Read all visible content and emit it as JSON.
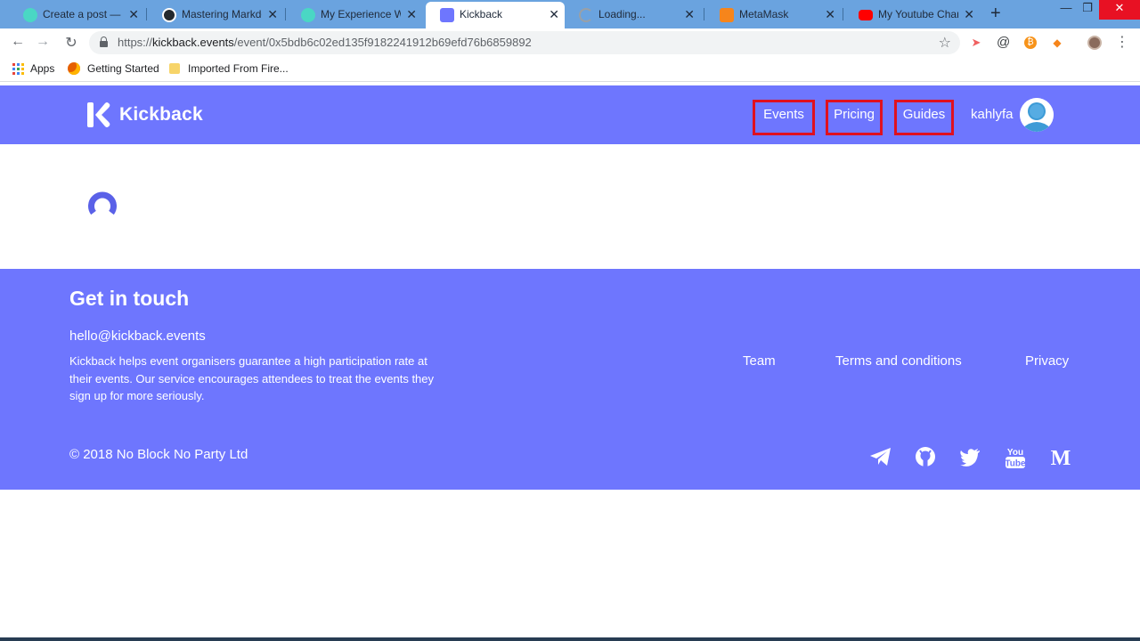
{
  "browser": {
    "tabs": [
      {
        "label": "Create a post — Sti",
        "favicon": "steemit-icon",
        "color": "#4ad7c4",
        "active": false
      },
      {
        "label": "Mastering Markdo",
        "favicon": "github-icon",
        "color": "#24292e",
        "active": false
      },
      {
        "label": "My Experience With",
        "favicon": "steemit-icon",
        "color": "#4ad7c4",
        "active": false
      },
      {
        "label": "Kickback",
        "favicon": "kickback-icon",
        "color": "#6e76fe",
        "active": true
      },
      {
        "label": "Loading...",
        "favicon": "loading-icon",
        "color": "#9aa0a6",
        "active": false
      },
      {
        "label": "MetaMask",
        "favicon": "metamask-icon",
        "color": "#f6851b",
        "active": false
      },
      {
        "label": "My Youtube Chann",
        "favicon": "youtube-icon",
        "color": "#ff0000",
        "active": false
      }
    ],
    "new_tab": "+",
    "window_controls": {
      "minimize": "—",
      "restore": "❐",
      "close": "✕"
    },
    "url": {
      "scheme": "https://",
      "host": "kickback.events",
      "path": "/event/0x5bdb6c02ed135f9182241912b69efd76b6859892"
    },
    "bookmarks": [
      {
        "label": "Apps",
        "icon": "apps-grid-icon"
      },
      {
        "label": "Getting Started",
        "icon": "firefox-icon"
      },
      {
        "label": "Imported From Fire...",
        "icon": "folder-icon"
      }
    ],
    "extensions": [
      {
        "name": "extension-arrow-icon",
        "color": "#f06060",
        "glyph": "➤"
      },
      {
        "name": "extension-at-icon",
        "color": "#5f6368",
        "glyph": "@"
      },
      {
        "name": "bitcoin-extension-icon",
        "color": "#f7931a",
        "glyph": "₿"
      },
      {
        "name": "metamask-extension-icon",
        "color": "#f6851b",
        "glyph": "◆"
      }
    ]
  },
  "site": {
    "brand": "Kickback",
    "nav": [
      {
        "label": "Events"
      },
      {
        "label": "Pricing"
      },
      {
        "label": "Guides"
      }
    ],
    "username": "kahlyfa",
    "footer": {
      "title": "Get in touch",
      "email": "hello@kickback.events",
      "description": "Kickback helps event organisers guarantee a high participation rate at their events. Our service encourages attendees to treat the events they sign up for more seriously.",
      "links": [
        "Team",
        "Terms and conditions",
        "Privacy"
      ],
      "copyright": "© 2018 No Block No Party Ltd",
      "social": [
        "telegram-icon",
        "github-icon",
        "twitter-icon",
        "youtube-icon",
        "medium-icon"
      ]
    },
    "colors": {
      "brand": "#6e76fe",
      "highlight": "#e0101f",
      "accent": "#5a61e8"
    }
  }
}
